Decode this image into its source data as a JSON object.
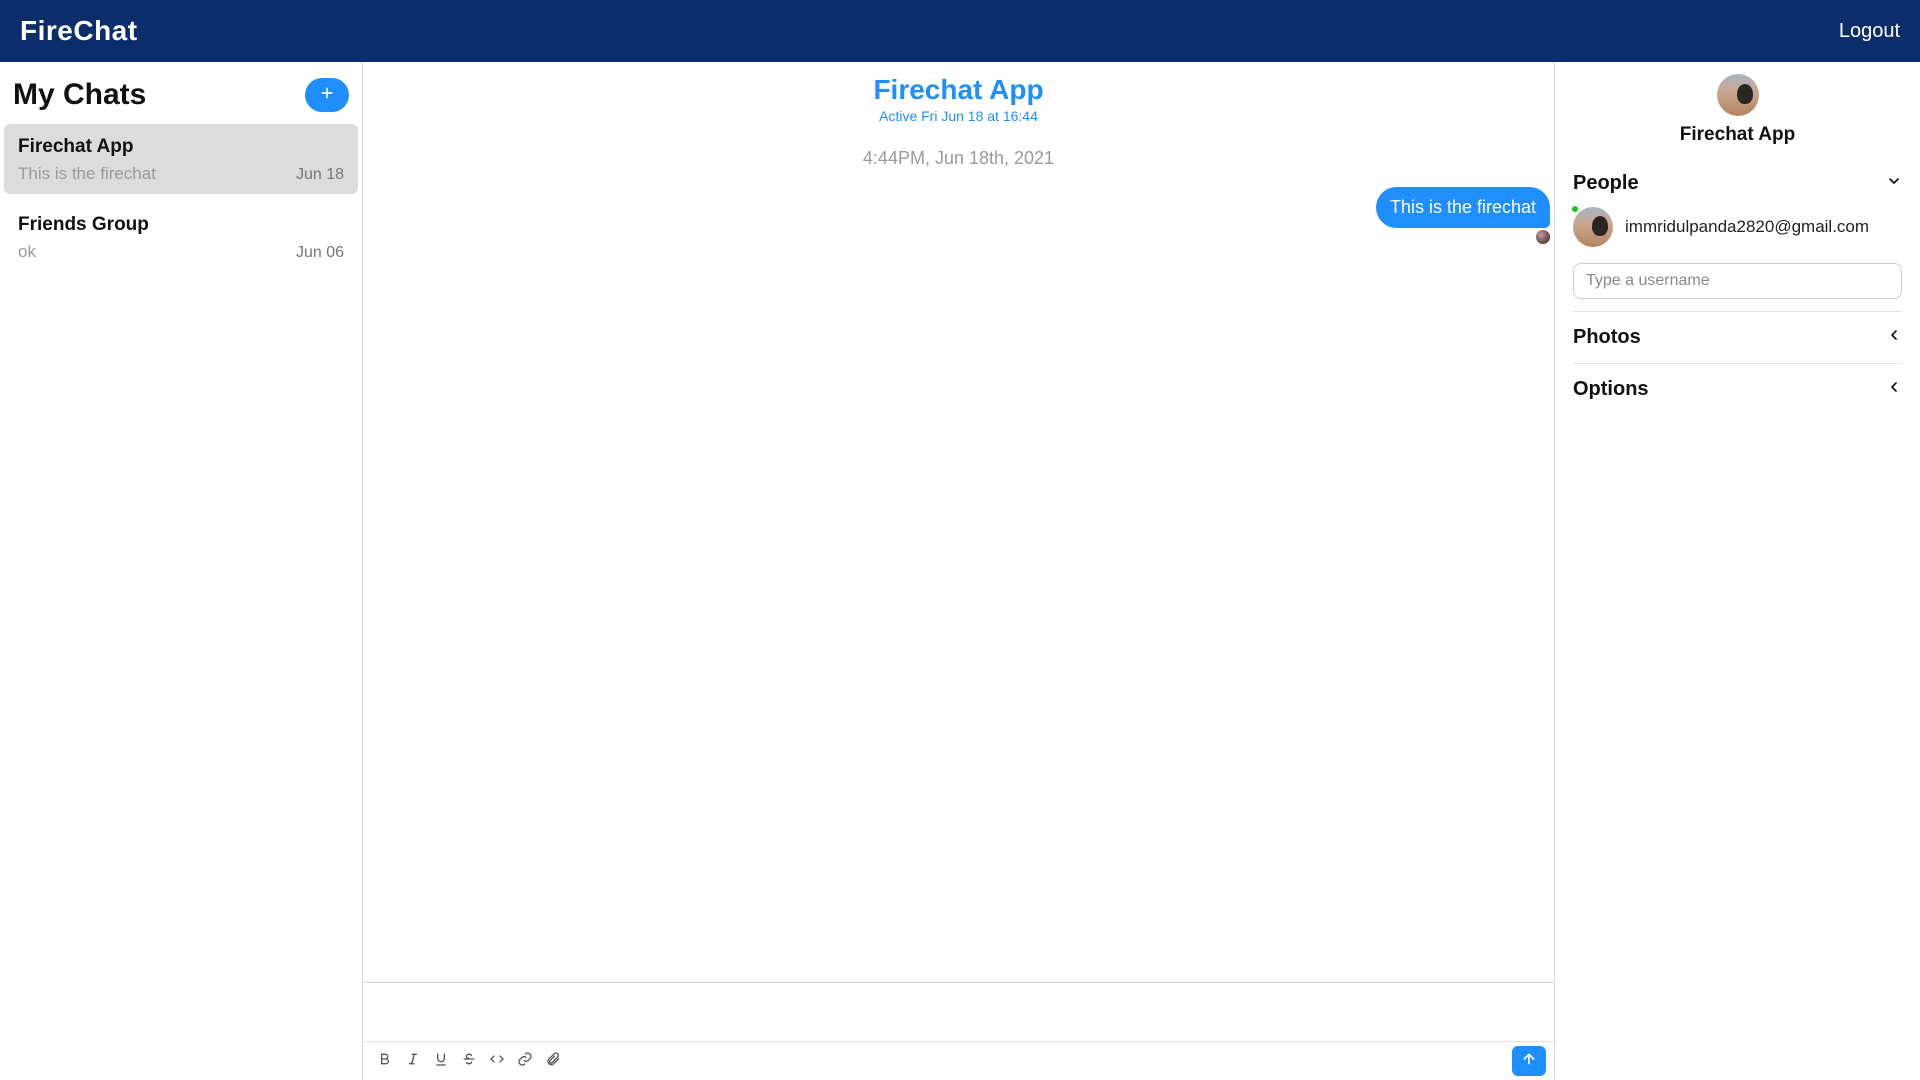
{
  "brand": "FireChat",
  "logout": "Logout",
  "sidebar": {
    "title": "My Chats",
    "chats": [
      {
        "name": "Firechat App",
        "preview": "This is the firechat",
        "date": "Jun 18",
        "selected": true
      },
      {
        "name": "Friends Group",
        "preview": "ok",
        "date": "Jun 06",
        "selected": false
      }
    ]
  },
  "chat": {
    "title": "Firechat App",
    "subtitle": "Active Fri Jun 18 at 16:44",
    "day_separator": "4:44PM, Jun 18th, 2021",
    "messages": [
      {
        "text": "This is the firechat",
        "mine": true
      }
    ],
    "compose_placeholder": ""
  },
  "right": {
    "title": "Firechat App",
    "sections": {
      "people": {
        "label": "People",
        "open": true
      },
      "photos": {
        "label": "Photos",
        "open": false
      },
      "options": {
        "label": "Options",
        "open": false
      }
    },
    "people": [
      {
        "email": "immridulpanda2820@gmail.com",
        "online": true
      }
    ],
    "add_user_placeholder": "Type a username"
  },
  "toolbar": {
    "bold": "bold",
    "italic": "italic",
    "underline": "underline",
    "strike": "strike",
    "code": "code",
    "link": "link",
    "attach": "attach",
    "send": "send"
  }
}
